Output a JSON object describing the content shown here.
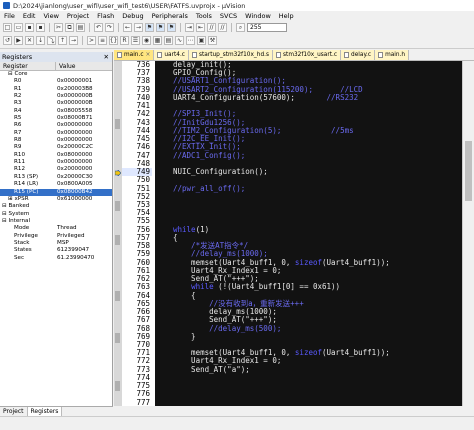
{
  "window": {
    "title": "D:\\2024\\jianlong\\user_wifi\\user_wifi_test6\\USER\\FATFS.uvprojx - µVision"
  },
  "menu": [
    "File",
    "Edit",
    "View",
    "Project",
    "Flash",
    "Debug",
    "Peripherals",
    "Tools",
    "SVCS",
    "Window",
    "Help"
  ],
  "toolbar": {
    "zoom_value": "255"
  },
  "registers": {
    "panel_title": "Registers",
    "col_register": "Register",
    "col_value": "Value",
    "rows": [
      {
        "name": "Core",
        "value": "",
        "indent": 1
      },
      {
        "name": "R0",
        "value": "0x00000001",
        "indent": 2
      },
      {
        "name": "R1",
        "value": "0x200003B8",
        "indent": 2
      },
      {
        "name": "R2",
        "value": "0x0000000B",
        "indent": 2
      },
      {
        "name": "R3",
        "value": "0x0000000B",
        "indent": 2
      },
      {
        "name": "R4",
        "value": "0x08005558",
        "indent": 2
      },
      {
        "name": "R5",
        "value": "0x08000B71",
        "indent": 2
      },
      {
        "name": "R6",
        "value": "0x00000000",
        "indent": 2
      },
      {
        "name": "R7",
        "value": "0x00000000",
        "indent": 2
      },
      {
        "name": "R8",
        "value": "0x00000000",
        "indent": 2
      },
      {
        "name": "R9",
        "value": "0x20000C2C",
        "indent": 2
      },
      {
        "name": "R10",
        "value": "0x08000000",
        "indent": 2
      },
      {
        "name": "R11",
        "value": "0x00000000",
        "indent": 2
      },
      {
        "name": "R12",
        "value": "0x20000000",
        "indent": 2
      },
      {
        "name": "R13 (SP)",
        "value": "0x20000C30",
        "indent": 2
      },
      {
        "name": "R14 (LR)",
        "value": "0x0800A005",
        "indent": 2
      },
      {
        "name": "R15 (PC)",
        "value": "0x08000B42",
        "indent": 2,
        "selected": true
      },
      {
        "name": "xPSR",
        "value": "0x61000000",
        "indent": 1
      },
      {
        "name": "Banked",
        "value": "",
        "indent": 0
      },
      {
        "name": "System",
        "value": "",
        "indent": 0
      },
      {
        "name": "Internal",
        "value": "",
        "indent": 0
      },
      {
        "name": "Mode",
        "value": "Thread",
        "indent": 2
      },
      {
        "name": "Privilege",
        "value": "Privileged",
        "indent": 2
      },
      {
        "name": "Stack",
        "value": "MSP",
        "indent": 2
      },
      {
        "name": "States",
        "value": "612399047",
        "indent": 2
      },
      {
        "name": "Sec",
        "value": "61.23990470",
        "indent": 2
      }
    ]
  },
  "bottom_tabs": [
    "Project",
    "Registers"
  ],
  "editor_tabs": [
    "main.c",
    "uart4.c",
    "startup_stm32f10x_hd.s",
    "stm32f10x_usart.c",
    "delay.c",
    "main.h"
  ],
  "editor": {
    "line_numbers": [
      "736",
      "737",
      "738",
      "739",
      "740",
      "741",
      "742",
      "743",
      "744",
      "745",
      "746",
      "747",
      "748",
      "749",
      "750",
      "751",
      "752",
      "753",
      "754",
      "755",
      "756",
      "757",
      "758",
      "759",
      "760",
      "761",
      "762",
      "763",
      "764",
      "765",
      "766",
      "767",
      "768",
      "769",
      "770",
      "771",
      "772",
      "773",
      "774",
      "775",
      "776",
      "777"
    ],
    "lines": [
      [
        {
          "t": "delay_init();",
          "c": "fn"
        }
      ],
      [
        {
          "t": "GPIO_Config();",
          "c": "fn"
        }
      ],
      [
        {
          "t": "//USART1_Configuration();",
          "c": "comment"
        }
      ],
      [
        {
          "t": "//USART2_Configuration(115200);      //LCD",
          "c": "comment"
        }
      ],
      [
        {
          "t": "UART4_Configuration(57600);",
          "c": "fn"
        },
        {
          "t": "       //RS232",
          "c": "comment"
        }
      ],
      [
        {
          "t": "",
          "c": "fn"
        }
      ],
      [
        {
          "t": "//SPI3_Init();",
          "c": "comment"
        }
      ],
      [
        {
          "t": "//InitGdu1256();",
          "c": "comment"
        }
      ],
      [
        {
          "t": "//TIM2_Configuration(5);           //5ms",
          "c": "comment"
        }
      ],
      [
        {
          "t": "//I2C_EE_Init();",
          "c": "comment"
        }
      ],
      [
        {
          "t": "//EXTIX_Init();",
          "c": "comment"
        }
      ],
      [
        {
          "t": "//ADC1_Config();",
          "c": "comment"
        }
      ],
      [
        {
          "t": "",
          "c": "fn"
        }
      ],
      [
        {
          "t": "NUIC_Configuration();",
          "c": "fn"
        }
      ],
      [
        {
          "t": "",
          "c": "fn"
        }
      ],
      [
        {
          "t": "//pwr_all_off();",
          "c": "comment"
        }
      ],
      [
        {
          "t": "",
          "c": "fn"
        }
      ],
      [
        {
          "t": "",
          "c": "fn"
        }
      ],
      [
        {
          "t": "",
          "c": "fn"
        }
      ],
      [
        {
          "t": "",
          "c": "fn"
        }
      ],
      [
        {
          "t": "while",
          "c": "kw"
        },
        {
          "t": "(1)",
          "c": "fn"
        }
      ],
      [
        {
          "t": "{",
          "c": "fn"
        }
      ],
      [
        {
          "t": "    /*发送AT指令*/",
          "c": "comment"
        }
      ],
      [
        {
          "t": "    //delay_ms(1000);",
          "c": "comment"
        }
      ],
      [
        {
          "t": "    memset(Uart4_buff1, 0, ",
          "c": "fn"
        },
        {
          "t": "sizeof",
          "c": "kw"
        },
        {
          "t": "(Uart4_buff1));",
          "c": "fn"
        }
      ],
      [
        {
          "t": "    Uart4_Rx_Index1 = 0;",
          "c": "fn"
        }
      ],
      [
        {
          "t": "    Send_AT(\"+++\");",
          "c": "fn"
        }
      ],
      [
        {
          "t": "    ",
          "c": "fn"
        },
        {
          "t": "while",
          "c": "kw"
        },
        {
          "t": " (!(Uart4_buff1[0] == 0x61))",
          "c": "fn"
        }
      ],
      [
        {
          "t": "    {",
          "c": "fn"
        }
      ],
      [
        {
          "t": "        //没有收到a，重新发送+++",
          "c": "comment"
        }
      ],
      [
        {
          "t": "        delay_ms(1000);",
          "c": "fn"
        }
      ],
      [
        {
          "t": "        Send_AT(\"+++\");",
          "c": "fn"
        }
      ],
      [
        {
          "t": "        //delay_ms(500);",
          "c": "comment"
        }
      ],
      [
        {
          "t": "    }",
          "c": "fn"
        }
      ],
      [
        {
          "t": "",
          "c": "fn"
        }
      ],
      [
        {
          "t": "    memset(Uart4_buff1, 0, ",
          "c": "fn"
        },
        {
          "t": "sizeof",
          "c": "kw"
        },
        {
          "t": "(Uart4_buff1));",
          "c": "fn"
        }
      ],
      [
        {
          "t": "    Uart4_Rx_Index1 = 0;",
          "c": "fn"
        }
      ],
      [
        {
          "t": "    Send_AT(\"a\");",
          "c": "fn"
        }
      ],
      [
        {
          "t": "",
          "c": "fn"
        }
      ],
      [
        {
          "t": "",
          "c": "fn"
        }
      ],
      [
        {
          "t": "",
          "c": "fn"
        }
      ],
      [
        {
          "t": "",
          "c": "fn"
        }
      ]
    ]
  },
  "colors": {
    "editor_bg": "#121212",
    "comment": "#6a6af0",
    "keyword": "#5a5aff",
    "selection": "#3370c8"
  }
}
